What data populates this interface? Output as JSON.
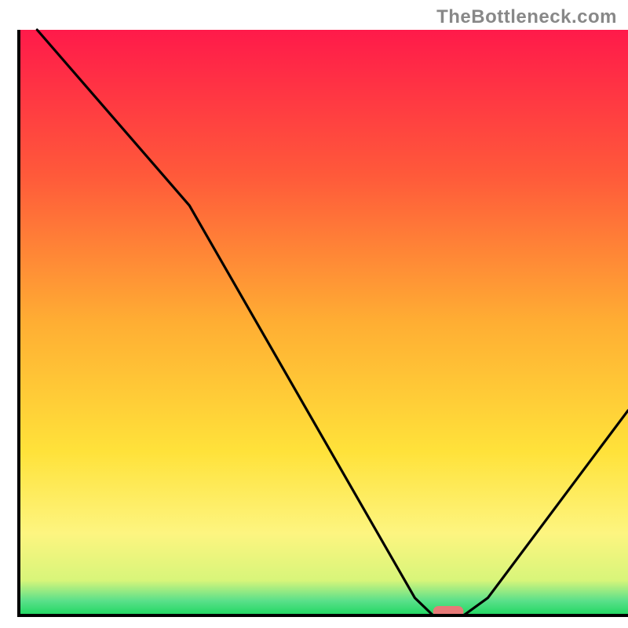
{
  "watermark": "TheBottleneck.com",
  "chart_data": {
    "type": "line",
    "title": "",
    "xlabel": "",
    "ylabel": "",
    "xlim": [
      0,
      100
    ],
    "ylim": [
      0,
      100
    ],
    "x": [
      3,
      28,
      65,
      68,
      73,
      77,
      100
    ],
    "values": [
      100,
      70,
      3,
      0,
      0,
      3,
      35
    ],
    "optimum_marker": {
      "x_start": 68,
      "x_end": 73,
      "color": "#e77a78"
    },
    "gradient_stops": [
      {
        "offset": 0.0,
        "color": "#ff1a4a"
      },
      {
        "offset": 0.25,
        "color": "#ff5a3a"
      },
      {
        "offset": 0.5,
        "color": "#ffae33"
      },
      {
        "offset": 0.72,
        "color": "#ffe23a"
      },
      {
        "offset": 0.86,
        "color": "#fdf580"
      },
      {
        "offset": 0.94,
        "color": "#d8f57a"
      },
      {
        "offset": 0.975,
        "color": "#5ae08a"
      },
      {
        "offset": 1.0,
        "color": "#1ed760"
      }
    ]
  }
}
